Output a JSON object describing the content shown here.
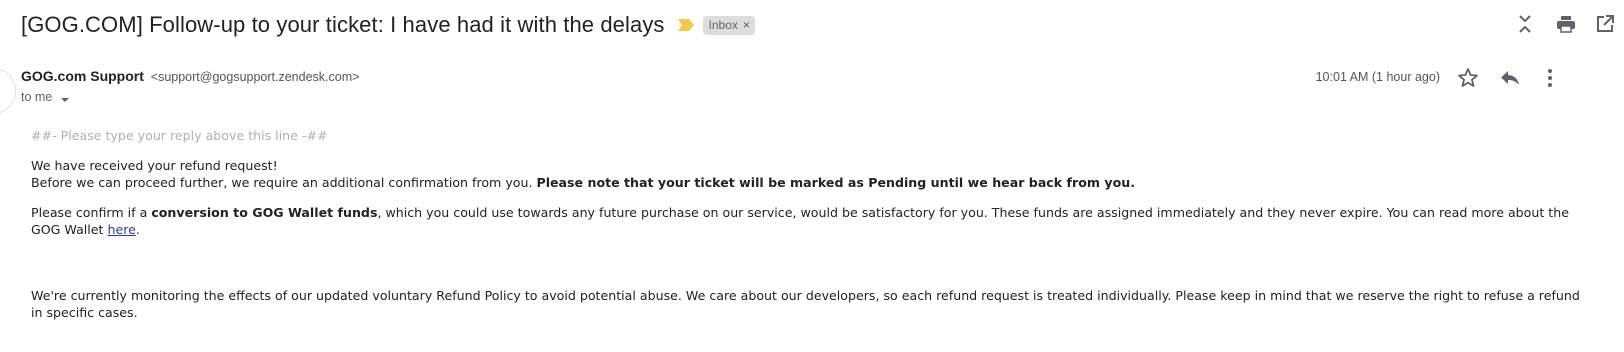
{
  "header": {
    "subject": "[GOG.COM] Follow-up to your ticket: I have had it with the delays",
    "label": "Inbox",
    "label_close": "×",
    "icons": [
      "expand-collapse-icon",
      "print-icon",
      "open-new-window-icon"
    ]
  },
  "sender": {
    "name": "GOG.com Support",
    "email": "<support@gogsupport.zendesk.com>",
    "to": "to me",
    "time": "10:01 AM (1 hour ago)",
    "icons": [
      "star-icon",
      "reply-icon",
      "more-vertical-icon"
    ]
  },
  "body": {
    "reply_marker": "##- Please type your reply above this line -##",
    "line1": "We have received your refund request!",
    "line2_start": "Before we can proceed further, we require an additional confirmation from you. ",
    "line2_bold": "Please note that your ticket will be marked as Pending until we hear back from you.",
    "para2_start": "Please confirm if a ",
    "para2_bold": "conversion to GOG Wallet funds",
    "para2_rest": ", which you could use towards any future purchase on our service, would be satisfactory for you. These funds are assigned immediately and they never expire. You can read more about the GOG Wallet ",
    "para2_link": "here",
    "para2_end": ".",
    "para3": "We're currently monitoring the effects of our updated voluntary Refund Policy to avoid potential abuse. We care about our developers, so each refund request is treated individually. Please keep in mind that we reserve the right to refuse a refund in specific cases."
  },
  "colors": {
    "importance_marker": "#f1c84b",
    "label_bg": "#dddddd",
    "link": "#2a37a5",
    "muted_text": "#b0b0b0"
  }
}
